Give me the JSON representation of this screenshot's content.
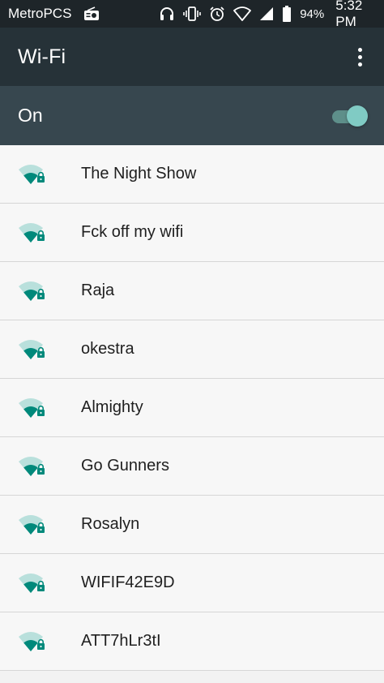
{
  "status_bar": {
    "carrier": "MetroPCS",
    "battery_percent": "94%",
    "time": "5:32 PM",
    "icons": [
      "radio-icon",
      "headset-icon",
      "vibrate-icon",
      "alarm-icon",
      "wifi-status-icon",
      "cell-signal-icon",
      "battery-icon"
    ]
  },
  "app_bar": {
    "title": "Wi-Fi",
    "overflow_icon": "more-vert-icon"
  },
  "master_switch": {
    "label": "On",
    "state": true
  },
  "networks": [
    {
      "name": "The Night Show",
      "secured": true
    },
    {
      "name": "Fck off my wifi",
      "secured": true
    },
    {
      "name": "Raja",
      "secured": true
    },
    {
      "name": "okestra",
      "secured": true
    },
    {
      "name": "Almighty",
      "secured": true
    },
    {
      "name": "Go Gunners",
      "secured": true
    },
    {
      "name": "Rosalyn",
      "secured": true
    },
    {
      "name": "WIFIF42E9D",
      "secured": true
    },
    {
      "name": "ATT7hLr3tI",
      "secured": true
    }
  ],
  "colors": {
    "status_bar": "#1e2529",
    "app_bar": "#263238",
    "switch_bar": "#37474f",
    "accent": "#80cbc4",
    "wifi_icon": "#00897b",
    "list_background": "#f7f7f7"
  }
}
